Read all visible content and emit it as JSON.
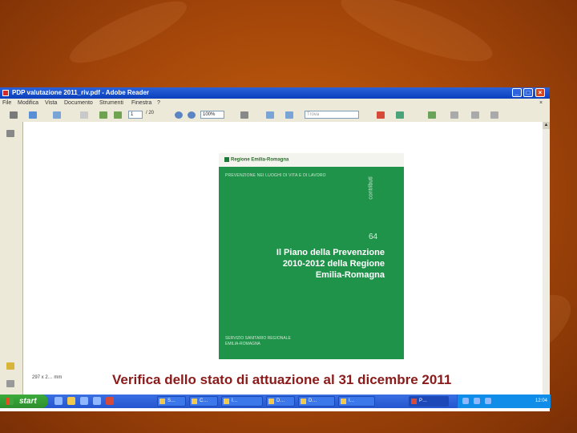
{
  "window": {
    "title": "PDP valutazione 2011_riv.pdf - Adobe Reader",
    "controls": {
      "minimize": "_",
      "maximize": "□",
      "close": "×"
    }
  },
  "menu": [
    "File",
    "Modifica",
    "Vista",
    "Documento",
    "Strumenti",
    "Finestra",
    "?"
  ],
  "toolbar": {
    "page_number": "1",
    "page_total": "/ 20",
    "zoom": "100%",
    "search_placeholder": "Trova"
  },
  "status": {
    "size": "297 x 2… mm"
  },
  "cover": {
    "logo": "Regione Emilia-Romagna",
    "collana": "PREVENZIONE NEI LUOGHI DI VITA E DI LAVORO",
    "side_label": "contributi",
    "number": "64",
    "title_lines": [
      "Il Piano della Prevenzione",
      "2010-2012 della Regione",
      "Emilia-Romagna"
    ],
    "footer_lines": [
      "SERVIZIO SANITARIO REGIONALE",
      "EMILIA-ROMAGNA"
    ]
  },
  "caption": "Verifica dello stato di attuazione al 31 dicembre 2011",
  "taskbar": {
    "start_label": "start",
    "tasks": [
      {
        "label": "S…"
      },
      {
        "label": "C…"
      },
      {
        "label": "I…"
      },
      {
        "label": "D…"
      },
      {
        "label": "D…"
      },
      {
        "label": "I…"
      },
      {
        "label": "P…"
      }
    ],
    "clock": "12:04"
  },
  "colors": {
    "background": "#a4460a",
    "caption": "#8b1a1a",
    "cover_green": "#20934a",
    "titlebar": "#0a3fbd"
  }
}
